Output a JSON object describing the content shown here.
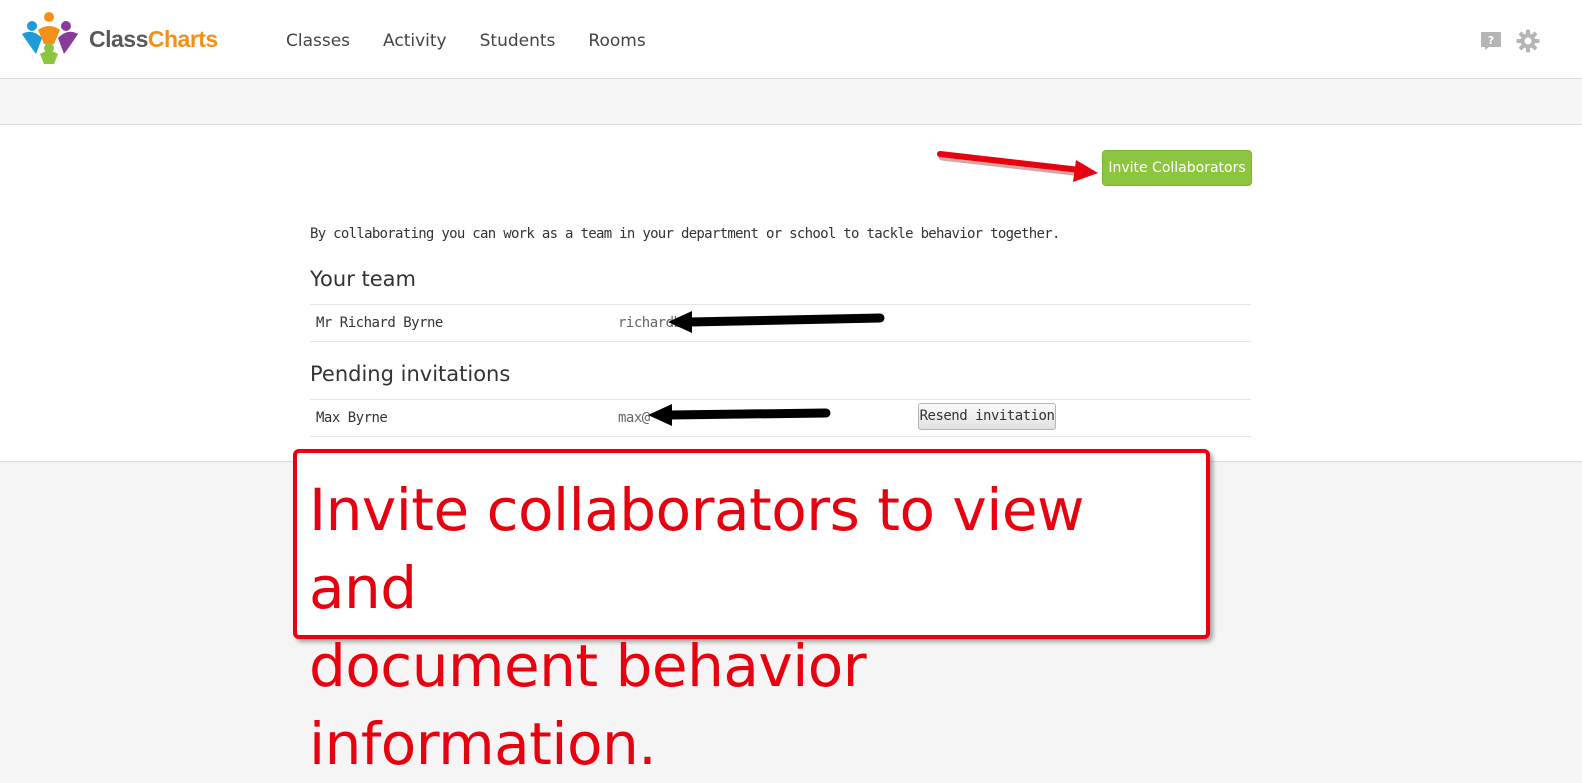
{
  "app": {
    "logo_part1": "Class",
    "logo_part2": "Charts"
  },
  "nav": {
    "items": [
      "Classes",
      "Activity",
      "Students",
      "Rooms"
    ]
  },
  "header_icons": {
    "help": "help-icon",
    "settings": "gear-icon"
  },
  "toolbar": {
    "invite_label": "Invite Collaborators"
  },
  "intro": "By collaborating you can work as a team in your department or school to tackle behavior together.",
  "team": {
    "title": "Your team",
    "members": [
      {
        "name": "Mr Richard Byrne",
        "email": "richardb"
      }
    ]
  },
  "pending": {
    "title": "Pending invitations",
    "invitations": [
      {
        "name": "Max Byrne",
        "email": "max@",
        "action": "Resend invitation"
      }
    ]
  },
  "annotation": {
    "line1": "Invite collaborators to view and",
    "line2": "document behavior information."
  },
  "colors": {
    "accent": "#8cc63f",
    "annotation_red": "#e8000f",
    "logo_orange": "#f39019"
  }
}
